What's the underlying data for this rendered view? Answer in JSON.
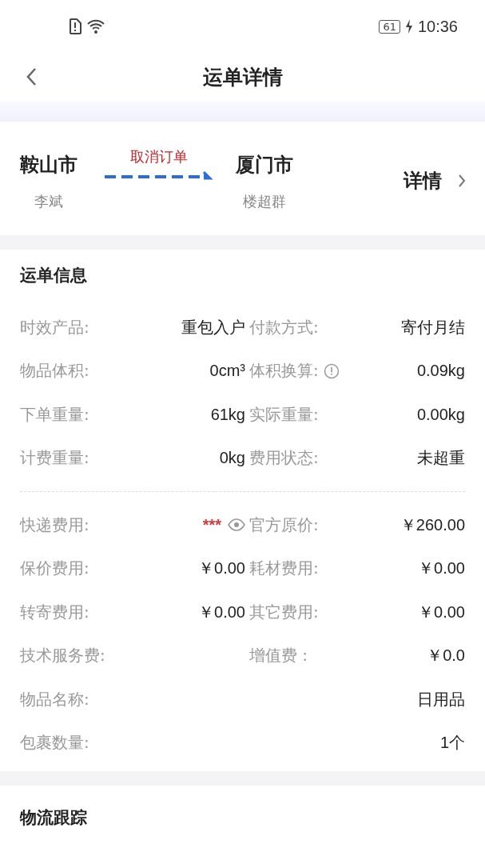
{
  "status_bar": {
    "battery": "61",
    "time": "10:36"
  },
  "header": {
    "title": "运单详情"
  },
  "route": {
    "from_city": "鞍山市",
    "from_name": "李斌",
    "status": "取消订单",
    "to_city": "厦门市",
    "to_name": "楼超群",
    "details": "详情"
  },
  "info": {
    "title": "运单信息",
    "groups": [
      [
        {
          "cells": [
            {
              "label": "时效产品:",
              "value": "重包入户",
              "kind": "text"
            },
            {
              "label": "付款方式:",
              "value": "寄付月结",
              "kind": "text"
            }
          ]
        },
        {
          "cells": [
            {
              "label": "物品体积:",
              "value": "0cm³",
              "kind": "text"
            },
            {
              "label": "体积换算:",
              "value": "0.09kg",
              "kind": "text",
              "info": true
            }
          ]
        },
        {
          "cells": [
            {
              "label": "下单重量:",
              "value": "61kg",
              "kind": "text"
            },
            {
              "label": "实际重量:",
              "value": "0.00kg",
              "kind": "text"
            }
          ]
        },
        {
          "cells": [
            {
              "label": "计费重量:",
              "value": "0kg",
              "kind": "text"
            },
            {
              "label": "费用状态:",
              "value": "未超重",
              "kind": "text"
            }
          ]
        }
      ],
      [
        {
          "cells": [
            {
              "label": "快递费用:",
              "value": "***",
              "kind": "masked"
            },
            {
              "label": "官方原价:",
              "value": "￥260.00",
              "kind": "text"
            }
          ]
        },
        {
          "cells": [
            {
              "label": "保价费用:",
              "value": "￥0.00",
              "kind": "text"
            },
            {
              "label": "耗材费用:",
              "value": "￥0.00",
              "kind": "text"
            }
          ]
        },
        {
          "cells": [
            {
              "label": "转寄费用:",
              "value": "￥0.00",
              "kind": "text"
            },
            {
              "label": "其它费用:",
              "value": "￥0.00",
              "kind": "text"
            }
          ]
        },
        {
          "cells": [
            {
              "label": "技术服务费:"
            },
            {
              "label": "增值费 :",
              "value": "￥0.0",
              "kind": "text"
            }
          ]
        },
        {
          "cells": [
            {
              "label": "物品名称:",
              "value": "日用品",
              "kind": "text"
            }
          ]
        },
        {
          "cells": [
            {
              "label": "包裹数量:",
              "value": "1个",
              "kind": "text"
            }
          ]
        }
      ]
    ]
  },
  "tracking": {
    "title": "物流跟踪"
  }
}
